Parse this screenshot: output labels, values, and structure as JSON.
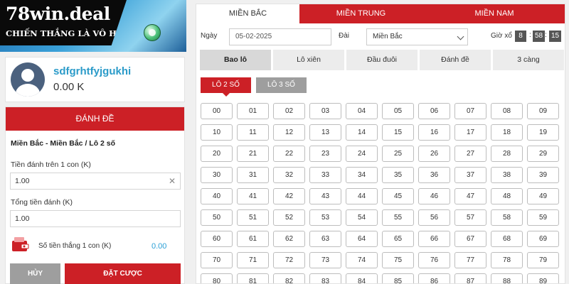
{
  "brand": {
    "logo_text": "78win.deal",
    "slogan": "CHIẾN THẮNG LÀ VÔ HẠN"
  },
  "user": {
    "username": "sdfgrhtfyjgukhi",
    "balance": "0.00 K"
  },
  "bet_panel": {
    "header": "ĐÁNH ĐỀ",
    "title": "Miền Bắc - Miền Bắc / Lô 2 số",
    "stake_label": "Tiền đánh trên 1 con (K)",
    "stake_value": "1.00",
    "total_label": "Tổng tiền đánh (K)",
    "total_value": "1.00",
    "win_label": "Số tiền thắng 1 con (K)",
    "win_value": "0.00",
    "cancel_label": "HỦY",
    "place_label": "ĐẶT CƯỢC"
  },
  "regions": [
    "MIỀN BẮC",
    "MIỀN TRUNG",
    "MIỀN NAM"
  ],
  "active_region": 0,
  "filters": {
    "date_label": "Ngày",
    "date_value": "05-02-2025",
    "station_label": "Đài",
    "station_value": "Miền Bắc",
    "draw_time_label": "Giờ xổ",
    "draw_time": [
      "8",
      "58",
      "15"
    ]
  },
  "bet_types": [
    "Bao lô",
    "Lô xiên",
    "Đầu đuôi",
    "Đánh đề",
    "3 càng"
  ],
  "active_bet_type": 0,
  "sub_tabs": [
    "LÔ 2 SỐ",
    "LÔ 3 SỐ"
  ],
  "numbers": [
    "00",
    "01",
    "02",
    "03",
    "04",
    "05",
    "06",
    "07",
    "08",
    "09",
    "10",
    "11",
    "12",
    "13",
    "14",
    "15",
    "16",
    "17",
    "18",
    "19",
    "20",
    "21",
    "22",
    "23",
    "24",
    "25",
    "26",
    "27",
    "28",
    "29",
    "30",
    "31",
    "32",
    "33",
    "34",
    "35",
    "36",
    "37",
    "38",
    "39",
    "40",
    "41",
    "42",
    "43",
    "44",
    "45",
    "46",
    "47",
    "48",
    "49",
    "50",
    "51",
    "52",
    "53",
    "54",
    "55",
    "56",
    "57",
    "58",
    "59",
    "60",
    "61",
    "62",
    "63",
    "64",
    "65",
    "66",
    "67",
    "68",
    "69",
    "70",
    "71",
    "72",
    "73",
    "74",
    "75",
    "76",
    "77",
    "78",
    "79",
    "80",
    "81",
    "82",
    "83",
    "84",
    "85",
    "86",
    "87",
    "88",
    "89"
  ],
  "colors": {
    "accent": "#cc2026",
    "link": "#2b9bc9"
  }
}
